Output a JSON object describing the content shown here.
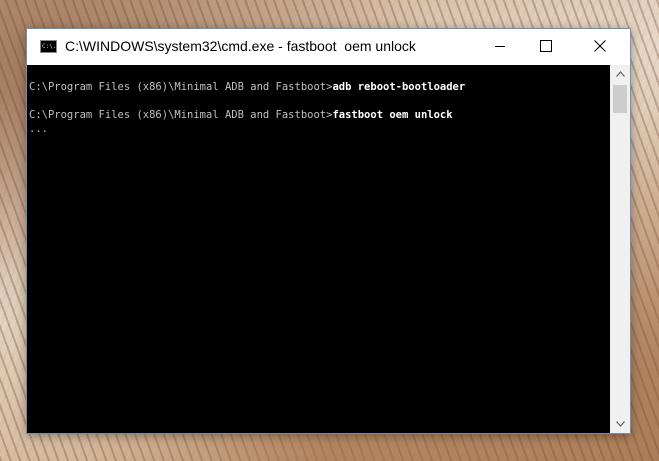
{
  "window": {
    "title": "C:\\WINDOWS\\system32\\cmd.exe - fastboot  oem unlock",
    "icon": "cmd-icon",
    "icon_text": "C:\\.",
    "buttons": {
      "minimize": "minimize-icon",
      "maximize": "maximize-icon",
      "close": "close-icon"
    }
  },
  "console": {
    "lines": [
      {
        "prompt": "C:\\Program Files (x86)\\Minimal ADB and Fastboot>",
        "command": "adb reboot-bootloader"
      },
      {
        "prompt": "",
        "command": ""
      },
      {
        "prompt": "C:\\Program Files (x86)\\Minimal ADB and Fastboot>",
        "command": "fastboot oem unlock"
      },
      {
        "prompt": "...",
        "command": ""
      }
    ],
    "background_color": "#000000",
    "text_color": "#c0c0c0"
  },
  "scrollbar": {
    "up_icon": "chevron-up-icon",
    "down_icon": "chevron-down-icon"
  }
}
